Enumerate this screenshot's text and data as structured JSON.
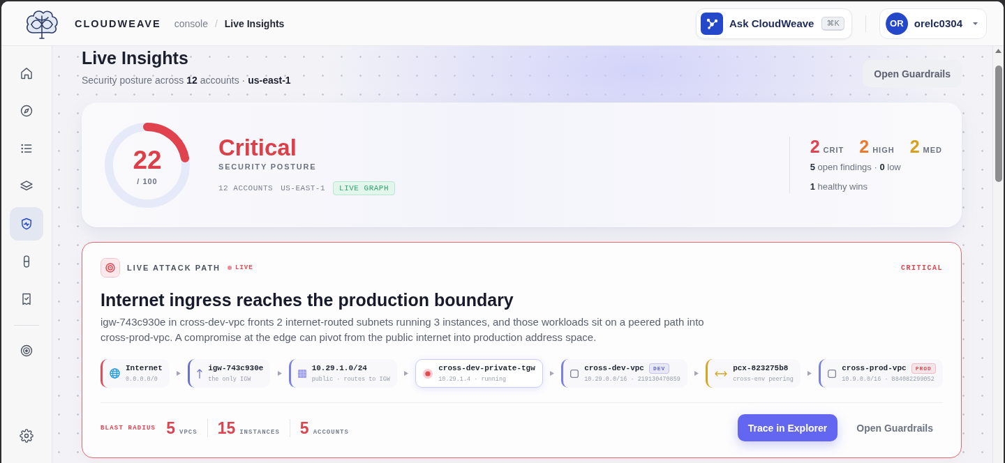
{
  "topbar": {
    "brand": "CLOUDWEAVE",
    "breadcrumb": [
      {
        "label": "console",
        "current": false
      },
      {
        "label": "Live Insights",
        "current": true
      }
    ],
    "separator": "/",
    "assistant": {
      "label": "Ask CloudWeave",
      "shortcut": "⌘K"
    },
    "user": {
      "initials": "OR",
      "name": "orelc0304"
    }
  },
  "sidebar": {
    "groups": [
      {
        "items": [
          {
            "kind": "home",
            "selected": false
          },
          {
            "kind": "compass",
            "selected": false
          },
          {
            "kind": "list",
            "selected": false
          },
          {
            "kind": "layers",
            "selected": false
          },
          {
            "kind": "shield",
            "selected": true
          },
          {
            "kind": "capsule",
            "selected": false
          },
          {
            "kind": "receipt",
            "selected": false
          }
        ]
      },
      {
        "items": [
          {
            "kind": "target",
            "selected": false
          }
        ]
      }
    ],
    "footer": [
      {
        "kind": "settings",
        "selected": false
      }
    ]
  },
  "header": {
    "title": "Live Insights",
    "subtitle": "Security posture across **12** accounts · **us-east-1**",
    "action": "Open Guardrails"
  },
  "posture": {
    "score": "22",
    "scale": "/ 100",
    "level": 0.22,
    "rating": "Critical",
    "label": "SECURITY POSTURE",
    "tags": [
      {
        "text": "12 ACCOUNTS",
        "kind": "plain"
      },
      {
        "text": "US-EAST-1",
        "kind": "plain"
      },
      {
        "text": "LIVE GRAPH",
        "kind": "badge"
      }
    ],
    "counts": [
      {
        "value": "2",
        "label": "CRIT",
        "color": "#e0434d"
      },
      {
        "value": "2",
        "label": "HIGH",
        "color": "#ec7a2c"
      },
      {
        "value": "2",
        "label": "MED",
        "color": "#d6a21c"
      }
    ],
    "findings": "**5** open findings · **0** low",
    "wins": "**1** healthy wins"
  },
  "attack_path": {
    "title": "LIVE ATTACK PATH",
    "status": "LIVE",
    "severity": "CRITICAL",
    "heading": "Internet ingress reaches the production boundary",
    "description": "igw-743c930e in cross-dev-vpc fronts 2 internet-routed subnets running 3 instances, and those workloads sit on a peered path into cross-prod-vpc. A compromise at the edge can pivot from the public internet into production address space.",
    "nodes": [
      {
        "kind": "internet",
        "title": "Internet",
        "detail": "0.0.0.0/0",
        "color": "#d9505a",
        "highlighted": false
      },
      {
        "kind": "gateway",
        "title": "igw-743c930e",
        "detail": "the only IGW",
        "color": "#6b6fd8",
        "highlighted": false
      },
      {
        "kind": "subnet",
        "title": "10.29.1.0/24",
        "detail": "public · routes to IGW",
        "color": "#7b7fe0",
        "highlighted": false
      },
      {
        "kind": "instance",
        "title": "cross-dev-private-tgw",
        "detail": "10.29.1.4 · running",
        "color": "#c9ccf4",
        "highlighted": true
      },
      {
        "kind": "vpc",
        "title": "cross-dev-vpc",
        "tag": {
          "text": "DEV",
          "color": "#6366d1"
        },
        "detail": "10.29.0.0/16 · 219130470859",
        "color": "#7b7fe0",
        "highlighted": false
      },
      {
        "kind": "peering",
        "title": "pcx-823275b8",
        "detail": "cross-env peering",
        "color": "#d9a521",
        "highlighted": false
      },
      {
        "kind": "vpc",
        "title": "cross-prod-vpc",
        "tag": {
          "text": "PROD",
          "color": "#d9505a"
        },
        "detail": "10.9.0.0/16 · 884082299052",
        "color": "#7b7fe0",
        "highlighted": false
      }
    ],
    "blast_radius": {
      "label": "BLAST RADIUS",
      "metrics": [
        {
          "value": "5",
          "unit": "VPCS"
        },
        {
          "value": "15",
          "unit": "INSTANCES"
        },
        {
          "value": "5",
          "unit": "ACCOUNTS"
        }
      ]
    },
    "actions": [
      {
        "label": "Trace in Explorer",
        "kind": "primary"
      },
      {
        "label": "Open Guardrails",
        "kind": "secondary"
      }
    ]
  }
}
